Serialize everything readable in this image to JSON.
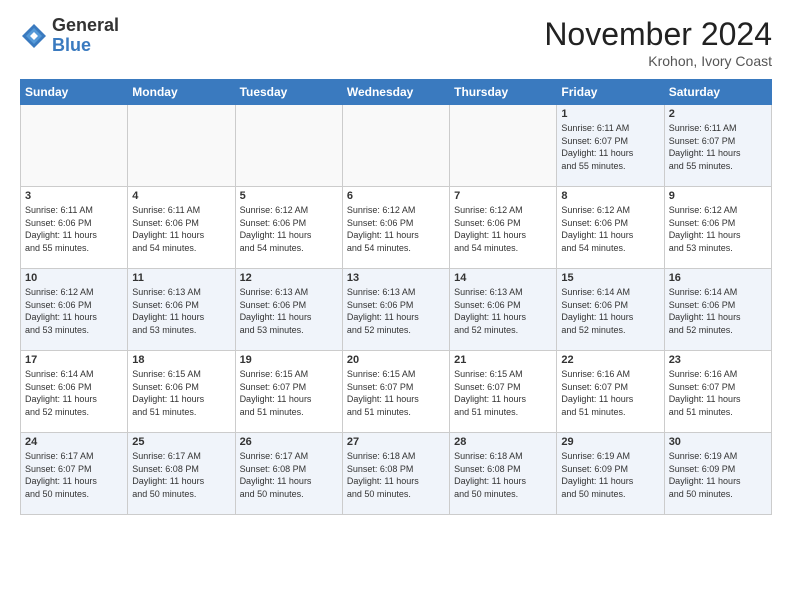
{
  "header": {
    "logo_general": "General",
    "logo_blue": "Blue",
    "month_title": "November 2024",
    "location": "Krohon, Ivory Coast"
  },
  "weekdays": [
    "Sunday",
    "Monday",
    "Tuesday",
    "Wednesday",
    "Thursday",
    "Friday",
    "Saturday"
  ],
  "weeks": [
    [
      {
        "day": "",
        "info": ""
      },
      {
        "day": "",
        "info": ""
      },
      {
        "day": "",
        "info": ""
      },
      {
        "day": "",
        "info": ""
      },
      {
        "day": "",
        "info": ""
      },
      {
        "day": "1",
        "info": "Sunrise: 6:11 AM\nSunset: 6:07 PM\nDaylight: 11 hours\nand 55 minutes."
      },
      {
        "day": "2",
        "info": "Sunrise: 6:11 AM\nSunset: 6:07 PM\nDaylight: 11 hours\nand 55 minutes."
      }
    ],
    [
      {
        "day": "3",
        "info": "Sunrise: 6:11 AM\nSunset: 6:06 PM\nDaylight: 11 hours\nand 55 minutes."
      },
      {
        "day": "4",
        "info": "Sunrise: 6:11 AM\nSunset: 6:06 PM\nDaylight: 11 hours\nand 54 minutes."
      },
      {
        "day": "5",
        "info": "Sunrise: 6:12 AM\nSunset: 6:06 PM\nDaylight: 11 hours\nand 54 minutes."
      },
      {
        "day": "6",
        "info": "Sunrise: 6:12 AM\nSunset: 6:06 PM\nDaylight: 11 hours\nand 54 minutes."
      },
      {
        "day": "7",
        "info": "Sunrise: 6:12 AM\nSunset: 6:06 PM\nDaylight: 11 hours\nand 54 minutes."
      },
      {
        "day": "8",
        "info": "Sunrise: 6:12 AM\nSunset: 6:06 PM\nDaylight: 11 hours\nand 54 minutes."
      },
      {
        "day": "9",
        "info": "Sunrise: 6:12 AM\nSunset: 6:06 PM\nDaylight: 11 hours\nand 53 minutes."
      }
    ],
    [
      {
        "day": "10",
        "info": "Sunrise: 6:12 AM\nSunset: 6:06 PM\nDaylight: 11 hours\nand 53 minutes."
      },
      {
        "day": "11",
        "info": "Sunrise: 6:13 AM\nSunset: 6:06 PM\nDaylight: 11 hours\nand 53 minutes."
      },
      {
        "day": "12",
        "info": "Sunrise: 6:13 AM\nSunset: 6:06 PM\nDaylight: 11 hours\nand 53 minutes."
      },
      {
        "day": "13",
        "info": "Sunrise: 6:13 AM\nSunset: 6:06 PM\nDaylight: 11 hours\nand 52 minutes."
      },
      {
        "day": "14",
        "info": "Sunrise: 6:13 AM\nSunset: 6:06 PM\nDaylight: 11 hours\nand 52 minutes."
      },
      {
        "day": "15",
        "info": "Sunrise: 6:14 AM\nSunset: 6:06 PM\nDaylight: 11 hours\nand 52 minutes."
      },
      {
        "day": "16",
        "info": "Sunrise: 6:14 AM\nSunset: 6:06 PM\nDaylight: 11 hours\nand 52 minutes."
      }
    ],
    [
      {
        "day": "17",
        "info": "Sunrise: 6:14 AM\nSunset: 6:06 PM\nDaylight: 11 hours\nand 52 minutes."
      },
      {
        "day": "18",
        "info": "Sunrise: 6:15 AM\nSunset: 6:06 PM\nDaylight: 11 hours\nand 51 minutes."
      },
      {
        "day": "19",
        "info": "Sunrise: 6:15 AM\nSunset: 6:07 PM\nDaylight: 11 hours\nand 51 minutes."
      },
      {
        "day": "20",
        "info": "Sunrise: 6:15 AM\nSunset: 6:07 PM\nDaylight: 11 hours\nand 51 minutes."
      },
      {
        "day": "21",
        "info": "Sunrise: 6:15 AM\nSunset: 6:07 PM\nDaylight: 11 hours\nand 51 minutes."
      },
      {
        "day": "22",
        "info": "Sunrise: 6:16 AM\nSunset: 6:07 PM\nDaylight: 11 hours\nand 51 minutes."
      },
      {
        "day": "23",
        "info": "Sunrise: 6:16 AM\nSunset: 6:07 PM\nDaylight: 11 hours\nand 51 minutes."
      }
    ],
    [
      {
        "day": "24",
        "info": "Sunrise: 6:17 AM\nSunset: 6:07 PM\nDaylight: 11 hours\nand 50 minutes."
      },
      {
        "day": "25",
        "info": "Sunrise: 6:17 AM\nSunset: 6:08 PM\nDaylight: 11 hours\nand 50 minutes."
      },
      {
        "day": "26",
        "info": "Sunrise: 6:17 AM\nSunset: 6:08 PM\nDaylight: 11 hours\nand 50 minutes."
      },
      {
        "day": "27",
        "info": "Sunrise: 6:18 AM\nSunset: 6:08 PM\nDaylight: 11 hours\nand 50 minutes."
      },
      {
        "day": "28",
        "info": "Sunrise: 6:18 AM\nSunset: 6:08 PM\nDaylight: 11 hours\nand 50 minutes."
      },
      {
        "day": "29",
        "info": "Sunrise: 6:19 AM\nSunset: 6:09 PM\nDaylight: 11 hours\nand 50 minutes."
      },
      {
        "day": "30",
        "info": "Sunrise: 6:19 AM\nSunset: 6:09 PM\nDaylight: 11 hours\nand 50 minutes."
      }
    ]
  ]
}
